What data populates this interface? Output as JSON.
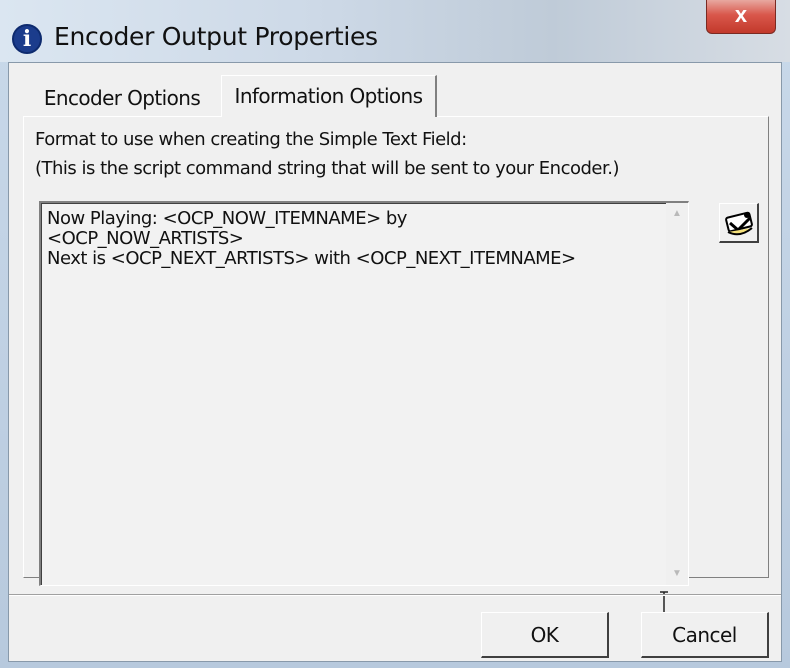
{
  "window": {
    "title": "Encoder Output Properties",
    "close_label": "x"
  },
  "tabs": [
    {
      "label": "Encoder Options",
      "active": false
    },
    {
      "label": "Information Options",
      "active": true
    }
  ],
  "panel": {
    "description_line1": "Format to use when creating the Simple Text Field:",
    "description_line2": "(This is the script command string that will be sent to your Encoder.)",
    "format_text": "Now Playing: <OCP_NOW_ITEMNAME> by\n<OCP_NOW_ARTISTS>\nNext is <OCP_NEXT_ARTISTS> with <OCP_NEXT_ITEMNAME>"
  },
  "buttons": {
    "ok": "OK",
    "cancel": "Cancel"
  },
  "icons": {
    "title": "info-icon",
    "side": "format-picker-icon",
    "scroll_up": "scroll-up-arrow-icon",
    "scroll_down": "scroll-down-arrow-icon"
  },
  "colors": {
    "close_button": "#c2392b",
    "info_icon": "#1b3c8c"
  }
}
